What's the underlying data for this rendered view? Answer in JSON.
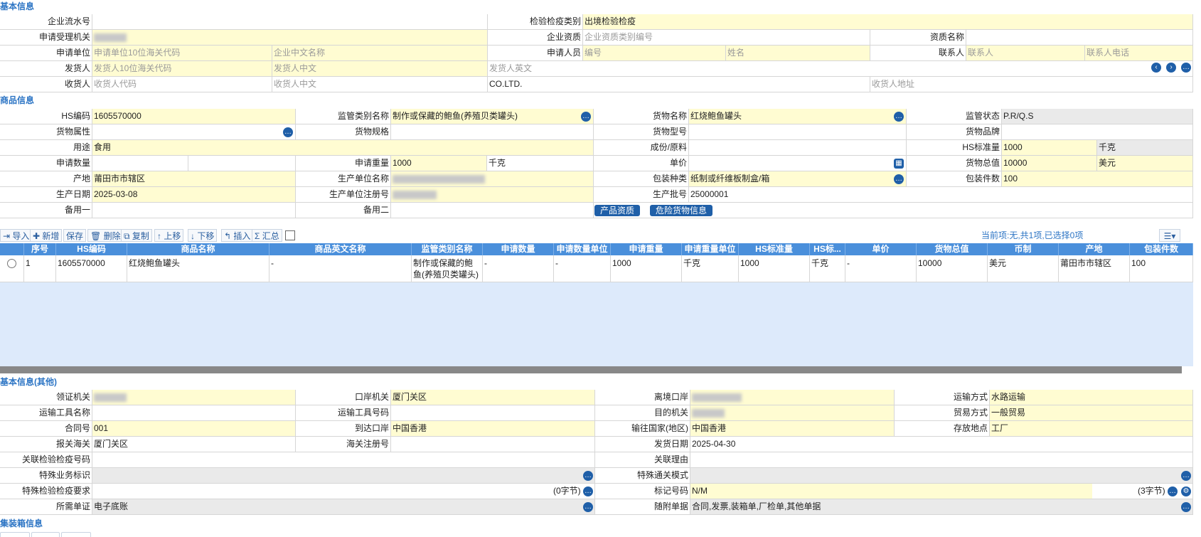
{
  "sections": {
    "basic": "基本信息",
    "goods": "商品信息",
    "other": "基本信息(其他)",
    "container": "集装箱信息"
  },
  "basic": {
    "serial_label": "企业流水号",
    "inspect_type_label": "检验检疫类别",
    "inspect_type_value": "出境检验检疫",
    "accept_org_label": "申请受理机关",
    "ent_qual_label": "企业资质",
    "ent_qual_ph": "企业资质类别编号",
    "qual_name_label": "资质名称",
    "applicant_label": "申请单位",
    "applicant_code_ph": "申请单位10位海关代码",
    "applicant_name_ph": "企业中文名称",
    "applicant_person_label": "申请人员",
    "person_no_ph": "编号",
    "person_name_ph": "姓名",
    "contact_label": "联系人",
    "contact_ph": "联系人",
    "contact_phone_ph": "联系人电话",
    "consignor_label": "发货人",
    "consignor_code_ph": "发货人10位海关代码",
    "consignor_cn_ph": "发货人中文",
    "consignor_en_ph": "发货人英文",
    "consignee_label": "收货人",
    "consignee_code_ph": "收货人代码",
    "consignee_cn_ph": "收货人中文",
    "consignee_en_value": "CO.LTD.",
    "consignee_addr_ph": "收货人地址"
  },
  "goods": {
    "hs_label": "HS编码",
    "hs_value": "1605570000",
    "sup_cat_label": "监管类别名称",
    "sup_cat_value": "制作或保藏的鲍鱼(养殖贝类罐头)",
    "name_label": "货物名称",
    "name_value": "红烧鲍鱼罐头",
    "sup_status_label": "监管状态",
    "sup_status_value": "P.R/Q.S",
    "attr_label": "货物属性",
    "spec_label": "货物规格",
    "model_label": "货物型号",
    "brand_label": "货物品牌",
    "use_label": "用途",
    "use_value": "食用",
    "component_label": "成份/原料",
    "hs_std_qty_label": "HS标准量",
    "hs_std_qty_value": "1000",
    "hs_std_unit": "千克",
    "apply_qty_label": "申请数量",
    "apply_weight_label": "申请重量",
    "apply_weight_value": "1000",
    "apply_weight_unit": "千克",
    "price_label": "单价",
    "total_label": "货物总值",
    "total_value": "10000",
    "currency": "美元",
    "origin_label": "产地",
    "origin_value": "莆田市市辖区",
    "maker_label": "生产单位名称",
    "pack_type_label": "包装种类",
    "pack_type_value": "纸制或纤维板制盒/箱",
    "pack_count_label": "包装件数",
    "pack_count_value": "100",
    "prod_date_label": "生产日期",
    "prod_date_value": "2025-03-08",
    "maker_reg_label": "生产单位注册号",
    "batch_label": "生产批号",
    "batch_value": "25000001",
    "spare1_label": "备用一",
    "spare2_label": "备用二",
    "btn_qual": "产品资质",
    "btn_danger": "危险货物信息"
  },
  "toolbar": {
    "import": "导入",
    "add": "新增",
    "save": "保存",
    "delete": "删除",
    "copy": "复制",
    "up": "上移",
    "down": "下移",
    "insert": "插入",
    "sum": "汇总",
    "status": "当前项:无,共1项,已选择0项"
  },
  "grid": {
    "headers": [
      "序号",
      "HS编码",
      "商品名称",
      "商品英文名称",
      "监管类别名称",
      "申请数量",
      "申请数量单位",
      "申请重量",
      "申请重量单位",
      "HS标准量",
      "HS标...",
      "单价",
      "货物总值",
      "币制",
      "产地",
      "包装件数"
    ],
    "row": [
      "1",
      "1605570000",
      "红烧鲍鱼罐头",
      "-",
      "制作或保藏的鲍鱼(养殖贝类罐头)",
      "-",
      "-",
      "1000",
      "千克",
      "1000",
      "千克",
      "-",
      "10000",
      "美元",
      "莆田市市辖区",
      "100"
    ]
  },
  "other": {
    "cert_org_label": "领证机关",
    "port_org_label": "口岸机关",
    "port_org_value": "厦门关区",
    "exit_port_label": "离境口岸",
    "transport_label": "运输方式",
    "transport_value": "水路运输",
    "vehicle_name_label": "运输工具名称",
    "vehicle_no_label": "运输工具号码",
    "dest_org_label": "目的机关",
    "trade_label": "贸易方式",
    "trade_value": "一般贸易",
    "contract_label": "合同号",
    "contract_value": "001",
    "arrive_port_label": "到达口岸",
    "arrive_port_value": "中国香港",
    "dest_country_label": "输往国家(地区)",
    "dest_country_value": "中国香港",
    "storage_label": "存放地点",
    "storage_value": "工厂",
    "customs_label": "报关海关",
    "customs_value": "厦门关区",
    "customs_reg_label": "海关注册号",
    "ship_date_label": "发货日期",
    "ship_date_value": "2025-04-30",
    "rel_no_label": "关联检验检疫号码",
    "rel_reason_label": "关联理由",
    "special_biz_label": "特殊业务标识",
    "special_clear_label": "特殊通关模式",
    "special_req_label": "特殊检验检疫要求",
    "special_req_count": "(0字节)",
    "mark_label": "标记号码",
    "mark_value": "N/M",
    "mark_count": "(3字节)",
    "need_cert_label": "所需单证",
    "need_cert_value": "电子底账",
    "attach_label": "随附单据",
    "attach_value": "合同,发票,装箱单,厂检单,其他单据"
  }
}
